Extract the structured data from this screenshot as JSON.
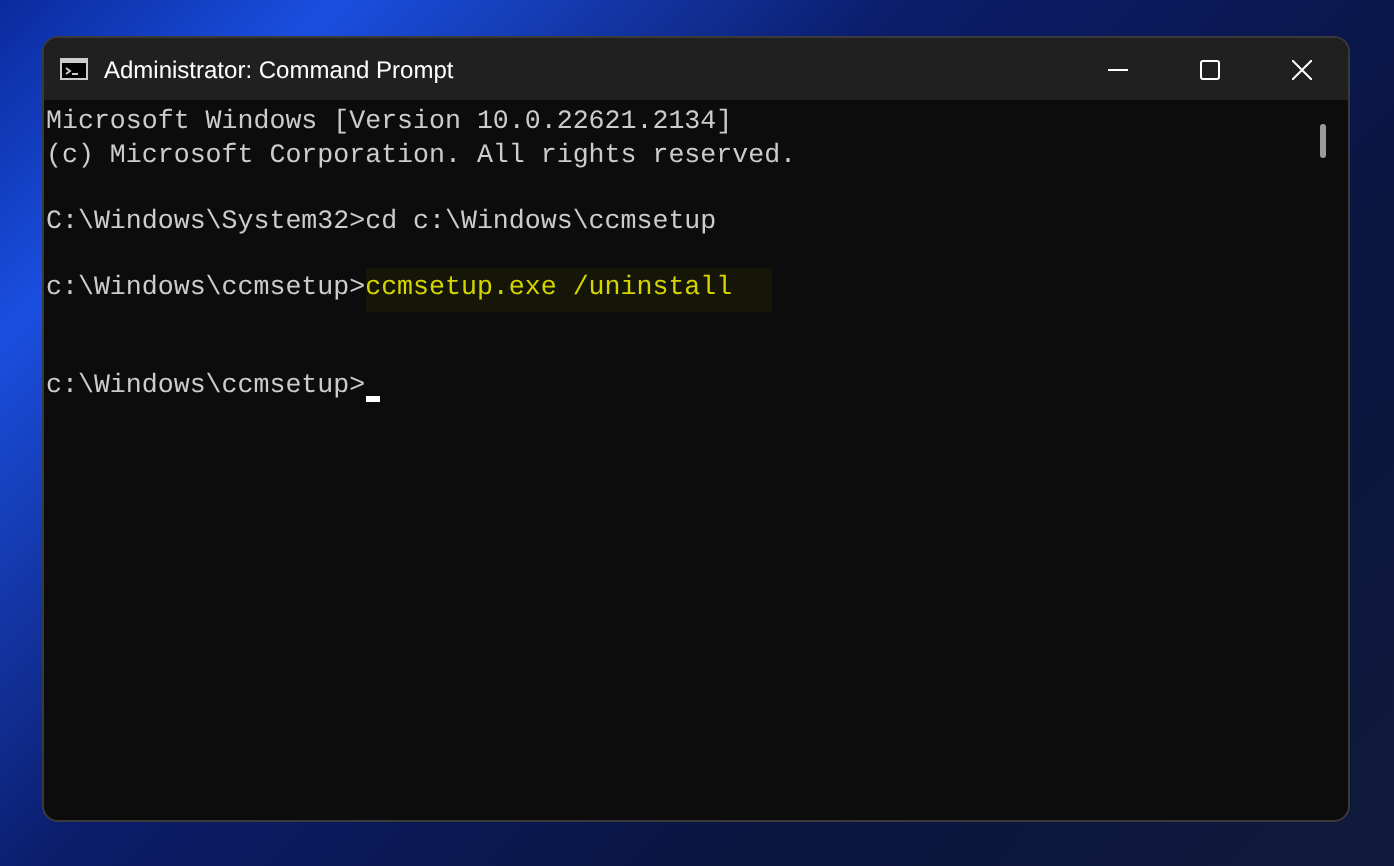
{
  "window": {
    "title": "Administrator: Command Prompt"
  },
  "console": {
    "lines": [
      {
        "kind": "output",
        "text": "Microsoft Windows [Version 10.0.22621.2134]"
      },
      {
        "kind": "output",
        "text": "(c) Microsoft Corporation. All rights reserved."
      },
      {
        "kind": "blank"
      },
      {
        "kind": "command",
        "prompt": "C:\\Windows\\System32>",
        "command": "cd c:\\Windows\\ccmsetup",
        "highlighted": false
      },
      {
        "kind": "blank"
      },
      {
        "kind": "command",
        "prompt": "c:\\Windows\\ccmsetup>",
        "command": "ccmsetup.exe /uninstall",
        "highlighted": true
      },
      {
        "kind": "blank"
      },
      {
        "kind": "blank"
      },
      {
        "kind": "prompt",
        "prompt": "c:\\Windows\\ccmsetup>",
        "cursor": true
      }
    ]
  }
}
